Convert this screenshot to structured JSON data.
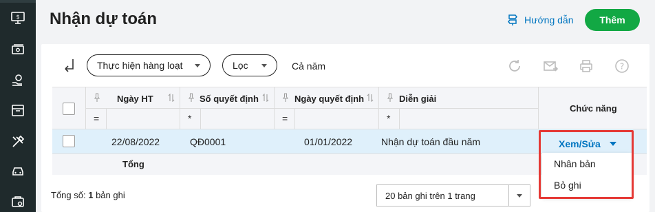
{
  "page": {
    "title": "Nhận dự toán",
    "guide_label": "Hướng dẫn",
    "add_label": "Thêm"
  },
  "toolbar": {
    "batch_label": "Thực hiện hàng loạt",
    "filter_label": "Lọc",
    "period_label": "Cả năm"
  },
  "table": {
    "columns": [
      "Ngày HT",
      "Số quyết định",
      "Ngày quyết định",
      "Diễn giải",
      "Chức năng"
    ],
    "filter_ops": [
      "=",
      "*",
      "=",
      "*"
    ],
    "rows": [
      {
        "ngay_ht": "22/08/2022",
        "so_quyet_dinh": "QĐ0001",
        "ngay_quyet_dinh": "01/01/2022",
        "dien_giai": "Nhận dự toán đầu năm",
        "action": "Xem/Sửa"
      }
    ],
    "total_label": "Tổng"
  },
  "menu": {
    "items": [
      "Nhân bản",
      "Bỏ ghi"
    ]
  },
  "footer": {
    "count_prefix": "Tổng số:",
    "count_value": "1",
    "count_suffix": "bản ghi",
    "pager_label": "20 bản ghi trên 1 trang"
  },
  "colors": {
    "sidebar": "#1f2a2c",
    "accent_blue": "#0075c0",
    "add_green": "#12a844",
    "highlight_red": "#e53935",
    "selected_row": "#dff0fb"
  },
  "icons": {
    "sidebar": [
      "monitor-dollar-icon",
      "cash-icon",
      "hand-coin-icon",
      "calendar-box-icon",
      "tools-icon",
      "car-icon",
      "wallet-icon"
    ],
    "toolbar": [
      "back-arrow-icon",
      "refresh-icon",
      "mail-icon",
      "print-icon",
      "help-icon"
    ]
  }
}
